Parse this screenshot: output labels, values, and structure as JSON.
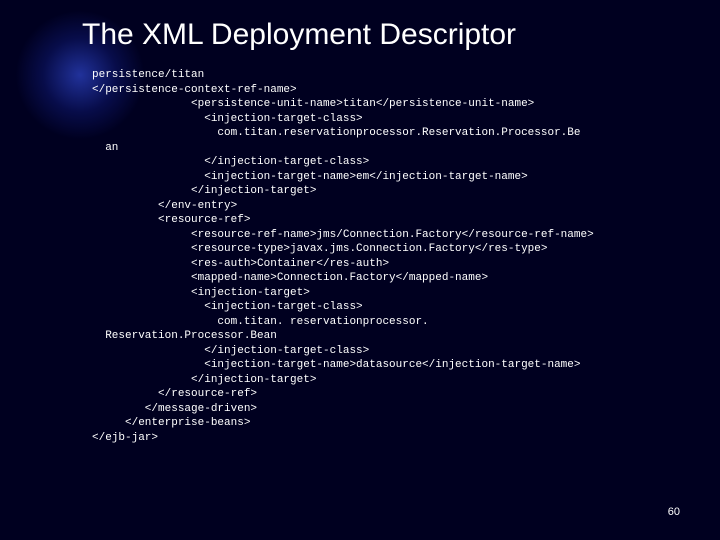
{
  "title": "The XML Deployment Descriptor",
  "page_number": "60",
  "code_lines": [
    "persistence/titan",
    "</persistence-context-ref-name>",
    "               <persistence-unit-name>titan</persistence-unit-name>",
    "                 <injection-target-class>",
    "                   com.titan.reservationprocessor.Reservation.Processor.Be",
    "  an",
    "                 </injection-target-class>",
    "                 <injection-target-name>em</injection-target-name>",
    "               </injection-target>",
    "          </env-entry>",
    "          <resource-ref>",
    "               <resource-ref-name>jms/Connection.Factory</resource-ref-name>",
    "               <resource-type>javax.jms.Connection.Factory</res-type>",
    "               <res-auth>Container</res-auth>",
    "               <mapped-name>Connection.Factory</mapped-name>",
    "               <injection-target>",
    "                 <injection-target-class>",
    "                   com.titan. reservationprocessor.",
    "  Reservation.Processor.Bean",
    "                 </injection-target-class>",
    "                 <injection-target-name>datasource</injection-target-name>",
    "               </injection-target>",
    "          </resource-ref>",
    "        </message-driven>",
    "     </enterprise-beans>",
    "</ejb-jar>"
  ]
}
